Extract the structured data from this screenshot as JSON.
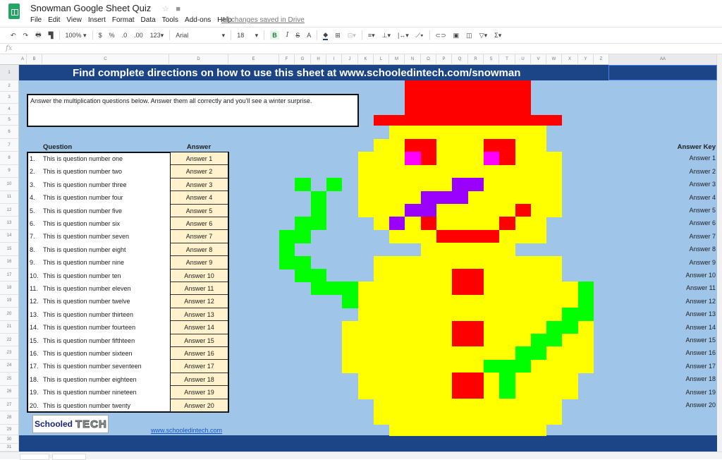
{
  "app": {
    "doc_title": "Snowman Google Sheet Quiz",
    "menu": [
      "File",
      "Edit",
      "View",
      "Insert",
      "Format",
      "Data",
      "Tools",
      "Add-ons",
      "Help"
    ],
    "save_status": "All changes saved in Drive"
  },
  "toolbar": {
    "zoom": "100%",
    "currency": "$",
    "percent": "%",
    "dec_decrease": ".0",
    "dec_increase": ".00",
    "format_more": "123",
    "font": "Arial",
    "font_size": "18",
    "bold": "B",
    "italic": "I",
    "strike": "S",
    "text_color": "A",
    "sum": "Σ"
  },
  "formula_bar": {
    "label": "fx"
  },
  "columns": [
    "A",
    "B",
    "C",
    "D",
    "E",
    "F",
    "G",
    "H",
    "I",
    "J",
    "K",
    "L",
    "M",
    "N",
    "O",
    "P",
    "Q",
    "R",
    "S",
    "T",
    "U",
    "V",
    "W",
    "X",
    "Y",
    "Z",
    "AA"
  ],
  "banner": {
    "prefix": "Find complete directions on how to use this sheet at ",
    "link": "www.schooledintech.com/snowman"
  },
  "instructions": "Answer the multiplication questions below. Answer them all correctly and you'll see a winter surprise.",
  "table": {
    "question_header": "Question",
    "answer_header": "Answer",
    "rows": [
      {
        "num": "1.",
        "q": "This is question number one",
        "a": "Answer 1"
      },
      {
        "num": "2.",
        "q": "This is question number two",
        "a": "Answer 2"
      },
      {
        "num": "3.",
        "q": "This is question number three",
        "a": "Answer 3"
      },
      {
        "num": "4.",
        "q": "This is question number four",
        "a": "Answer 4"
      },
      {
        "num": "5.",
        "q": "This is question number five",
        "a": "Answer 5"
      },
      {
        "num": "6.",
        "q": "This is question number six",
        "a": "Answer 6"
      },
      {
        "num": "7.",
        "q": "This is question number seven",
        "a": "Answer 7"
      },
      {
        "num": "8.",
        "q": "This is question number eight",
        "a": "Answer 8"
      },
      {
        "num": "9.",
        "q": "This is question number nine",
        "a": "Answer 9"
      },
      {
        "num": "10.",
        "q": "This is question number ten",
        "a": "Answer 10"
      },
      {
        "num": "11.",
        "q": "This is question number eleven",
        "a": "Answer 11"
      },
      {
        "num": "12.",
        "q": "This is question number twelve",
        "a": "Answer 12"
      },
      {
        "num": "13.",
        "q": "This is question number thirteen",
        "a": "Answer 13"
      },
      {
        "num": "14.",
        "q": "This is question number fourteen",
        "a": "Answer 14"
      },
      {
        "num": "15.",
        "q": "This is question number fifthteen",
        "a": "Answer 15"
      },
      {
        "num": "16.",
        "q": "This is question number sixteen",
        "a": "Answer 16"
      },
      {
        "num": "17.",
        "q": "This is question number seventeen",
        "a": "Answer 17"
      },
      {
        "num": "18.",
        "q": "This is question number eighteen",
        "a": "Answer 18"
      },
      {
        "num": "19.",
        "q": "This is question number nineteen",
        "a": "Answer 19"
      },
      {
        "num": "20.",
        "q": "This is question number twenty",
        "a": "Answer 20"
      }
    ]
  },
  "answer_key": {
    "header": "Answer Key",
    "values": [
      "Answer 1",
      "Answer 2",
      "Answer 3",
      "Answer 4",
      "Answer 5",
      "Answer 6",
      "Answer 7",
      "Answer 8",
      "Answer 9",
      "Answer 10",
      "Answer 11",
      "Answer 12",
      "Answer 13",
      "Answer 14",
      "Answer 15",
      "Answer 16",
      "Answer 17",
      "Answer 18",
      "Answer 19",
      "Answer 20"
    ]
  },
  "footer": {
    "logo_text_1": "Schooled",
    "logo_text_2": "TECH",
    "link": "www.schooledintech.com"
  },
  "pixel_art": {
    "palette": {
      "R": "#ff0000",
      "Y": "#ffff00",
      "G": "#00ff00",
      "P": "#9900ff",
      "M": "#ff00ff",
      "bg": "#9fc5e8",
      "banner": "#1c4587",
      "answer_cell": "#fff2cc"
    },
    "first_column": "F",
    "first_row": 2,
    "rows": [
      "........RRRRRRRR.....",
      "........RRRRRRRR.....",
      "........RRRRRRRR.....",
      "......RRRRRRRRRRRR...",
      ".......YYYYYYYYYY....",
      "......YYRRYYYRRYY....",
      ".....YYYMRYYYMRYYY...",
      ".....YYYYYYYYYYYYY...",
      ".G.G.YYYYYYPPYYYYY...",
      "..G..YYYYPPPYYYYYY...",
      "..G..YYYPPYYYYYRYY...",
      ".GG...YPYRYYYYRYY....",
      "GG.....YYYRRRRYYY....",
      "G........YYYYYY......",
      "GG....YYYYYYYYYYYY...",
      ".GG...YYYYYRRYYYYY...",
      "..GGGYYYYYYRRYYYYYYG.",
      "....GYYYYYYYYYYYYYYG.",
      ".....YYYYYYYYYYYYYGG.",
      "....YYYYYYYRRYYYYGGY.",
      "....YYYYYYYRRYYYGGYY.",
      "....YYYYYYYYYYYGGYYY.",
      "....YYYYYYYYYGGGYYYY.",
      ".....YYYYYYRRYGYYYY..",
      ".....YYYYYYRRYGYYYY..",
      "......YYYYYYYYYYYY...",
      "......YYYYYYYYYYYY...",
      ".......YYYYYYYYYY...."
    ]
  }
}
